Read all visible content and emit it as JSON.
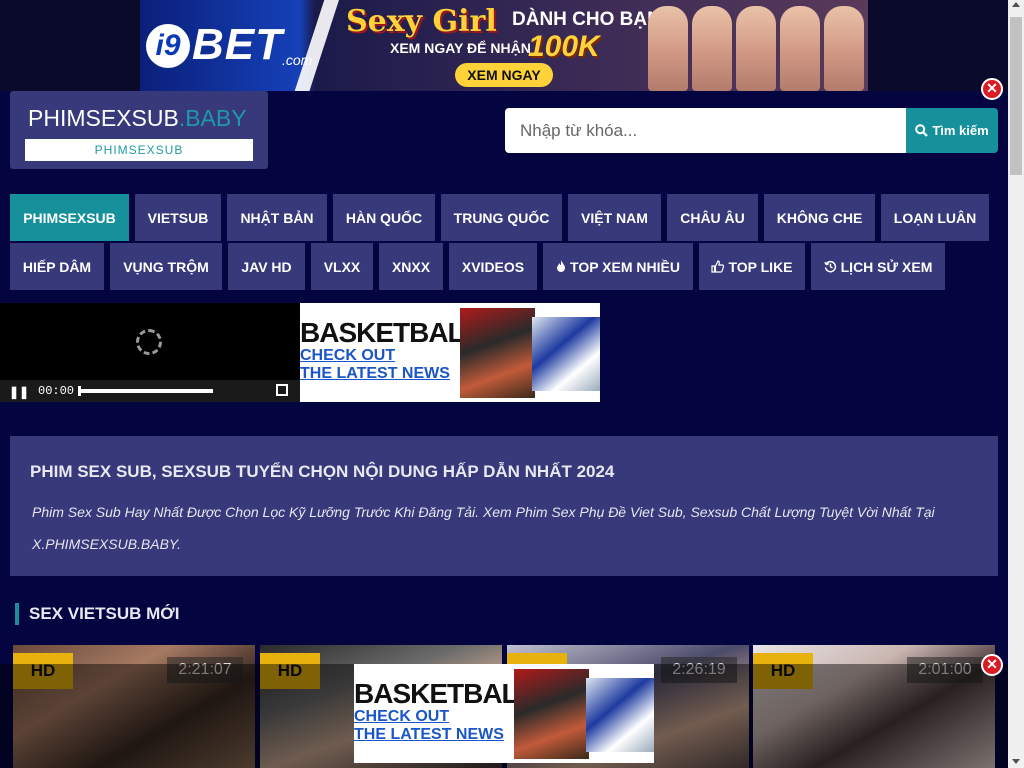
{
  "top_banner": {
    "logo_prefix": "i9",
    "logo_main": "BET",
    "logo_suffix": ".com",
    "headline": "Sexy Girl",
    "subtitle": "DÀNH CHO BẠN",
    "line2": "XEM NGAY ĐỂ NHẬN",
    "amount": "100K",
    "cta": "XEM NGAY"
  },
  "close_label": "✕",
  "logo": {
    "main": "PHIMSEXSUB",
    "suffix": ".BABY",
    "sub": "PHIMSEXSUB"
  },
  "search": {
    "placeholder": "Nhập từ khóa...",
    "button_label": "Tìm kiếm"
  },
  "nav": {
    "row1": [
      "PHIMSEXSUB",
      "VIETSUB",
      "NHẬT BẢN",
      "HÀN QUỐC",
      "TRUNG QUỐC",
      "VIỆT NAM",
      "CHÂU ÂU",
      "KHÔNG CHE",
      "LOẠN LUÂN"
    ],
    "row2": [
      "HIẾP DÂM",
      "VỤNG TRỘM",
      "JAV HD",
      "VLXX",
      "XNXX",
      "XVIDEOS",
      "TOP XEM NHIỀU",
      "TOP LIKE",
      "LỊCH SỬ XEM"
    ]
  },
  "player": {
    "time": "00:00",
    "progress": 0.0
  },
  "ad": {
    "title": "BASKETBALL",
    "link1": "CHECK OUT",
    "link2": "THE LATEST NEWS"
  },
  "intro": {
    "heading": "PHIM SEX SUB, SEXSUB TUYỂN CHỌN NỘI DUNG HẤP DẪN NHẤT 2024",
    "text": "Phim Sex Sub Hay Nhất Được Chọn Lọc Kỹ Lưỡng Trước Khi Đăng Tải. Xem Phim Sex Phụ Đề Viet Sub, Sexsub Chất Lượng Tuyệt Vời Nhất Tại X.PHIMSEXSUB.BABY."
  },
  "section": {
    "title": "SEX VIETSUB MỚI"
  },
  "videos": [
    {
      "badge": "HD",
      "duration": "2:21:07"
    },
    {
      "badge": "HD",
      "duration": ""
    },
    {
      "badge": "HD",
      "duration": "2:26:19"
    },
    {
      "badge": "HD",
      "duration": "2:01:00"
    }
  ],
  "colors": {
    "background": "#040440",
    "panel": "#37397a",
    "accent": "#16919c",
    "badge": "#e7b20b",
    "close": "#d91b24"
  },
  "icons": {
    "search": "search-icon",
    "fire": "fire-icon",
    "thumbs_up": "thumbs-up-icon",
    "history": "history-icon"
  }
}
